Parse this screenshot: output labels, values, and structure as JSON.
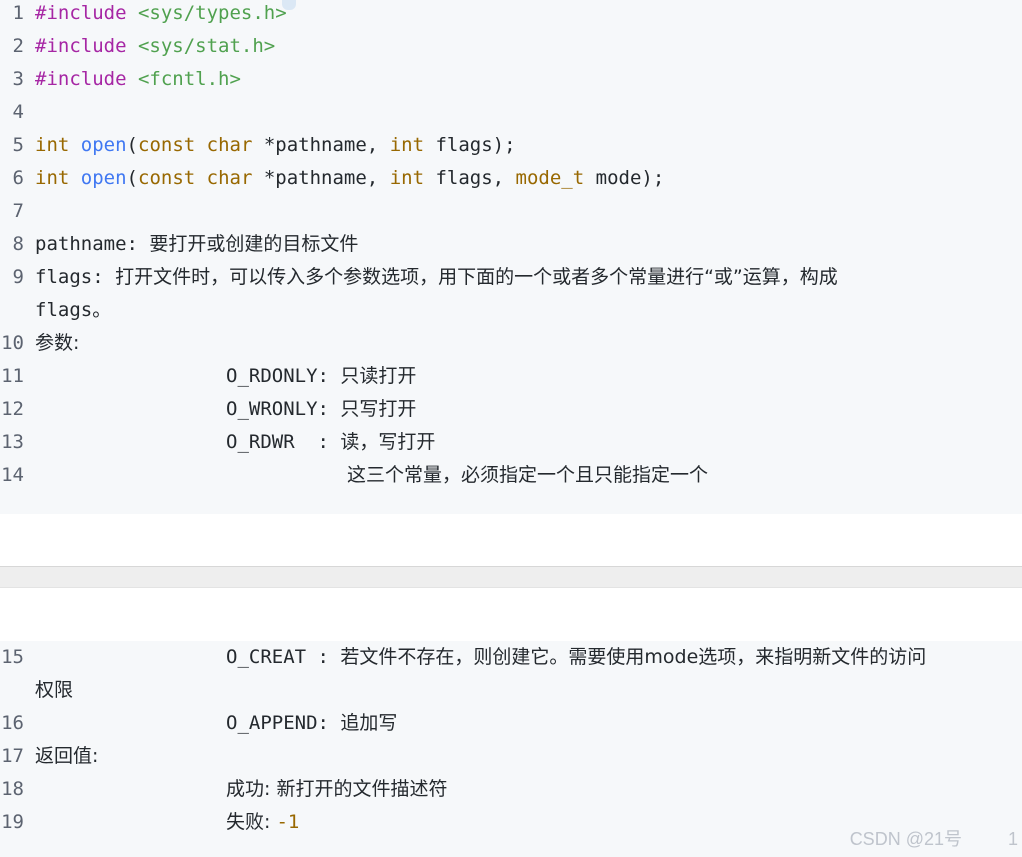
{
  "block1": [
    {
      "n": "1",
      "parts": [
        {
          "t": "#include",
          "c": "kw"
        },
        {
          "t": " "
        },
        {
          "t": "<sys/types.h>",
          "c": "str"
        }
      ]
    },
    {
      "n": "2",
      "parts": [
        {
          "t": "#include",
          "c": "kw"
        },
        {
          "t": " "
        },
        {
          "t": "<sys/stat.h>",
          "c": "str"
        }
      ]
    },
    {
      "n": "3",
      "parts": [
        {
          "t": "#include",
          "c": "kw"
        },
        {
          "t": " "
        },
        {
          "t": "<fcntl.h>",
          "c": "str"
        }
      ]
    },
    {
      "n": "4",
      "parts": []
    },
    {
      "n": "5",
      "parts": [
        {
          "t": "int",
          "c": "type"
        },
        {
          "t": " "
        },
        {
          "t": "open",
          "c": "fn"
        },
        {
          "t": "("
        },
        {
          "t": "const",
          "c": "type"
        },
        {
          "t": " "
        },
        {
          "t": "char",
          "c": "type"
        },
        {
          "t": " *pathname, "
        },
        {
          "t": "int",
          "c": "type"
        },
        {
          "t": " flags);"
        }
      ]
    },
    {
      "n": "6",
      "parts": [
        {
          "t": "int",
          "c": "type"
        },
        {
          "t": " "
        },
        {
          "t": "open",
          "c": "fn"
        },
        {
          "t": "("
        },
        {
          "t": "const",
          "c": "type"
        },
        {
          "t": " "
        },
        {
          "t": "char",
          "c": "type"
        },
        {
          "t": " *pathname, "
        },
        {
          "t": "int",
          "c": "type"
        },
        {
          "t": " flags, "
        },
        {
          "t": "mode_t",
          "c": "type"
        },
        {
          "t": " mode);"
        }
      ]
    },
    {
      "n": "7",
      "parts": []
    },
    {
      "n": "8",
      "parts": [
        {
          "t": "pathname: "
        },
        {
          "t": "要打开或创建的目标文件",
          "c": "cjk"
        }
      ]
    },
    {
      "n": "9",
      "parts": [
        {
          "t": "flags: "
        },
        {
          "t": "打开文件时，可以传入多个参数选项，用下面的一个或者多个常量进行“或”运算，构成",
          "c": "cjk"
        }
      ],
      "cont": [
        {
          "t": "flags"
        },
        {
          "t": "。",
          "c": "cjk"
        }
      ]
    },
    {
      "n": "10",
      "parts": [
        {
          "t": "参数:",
          "c": "cjk"
        }
      ]
    },
    {
      "n": "11",
      "indent": 1,
      "parts": [
        {
          "t": "O_RDONLY: "
        },
        {
          "t": "只读打开",
          "c": "cjk"
        }
      ]
    },
    {
      "n": "12",
      "indent": 1,
      "parts": [
        {
          "t": "O_WRONLY: "
        },
        {
          "t": "只写打开",
          "c": "cjk"
        }
      ]
    },
    {
      "n": "13",
      "indent": 1,
      "parts": [
        {
          "t": "O_RDWR  : "
        },
        {
          "t": "读，写打开",
          "c": "cjk"
        }
      ]
    },
    {
      "n": "14",
      "indent": 2,
      "parts": [
        {
          "t": "这三个常量，必须指定一个且只能指定一个",
          "c": "cjk"
        }
      ]
    }
  ],
  "block2": [
    {
      "n": "15",
      "indent": 1,
      "parts": [
        {
          "t": "O_CREAT : "
        },
        {
          "t": "若文件不存在，则创建它。需要使用mode选项，来指明新文件的访问",
          "c": "cjk"
        }
      ],
      "cont": [
        {
          "t": "权限",
          "c": "cjk"
        }
      ]
    },
    {
      "n": "16",
      "indent": 1,
      "parts": [
        {
          "t": "O_APPEND: "
        },
        {
          "t": "追加写",
          "c": "cjk"
        }
      ]
    },
    {
      "n": "17",
      "parts": [
        {
          "t": "返回值:",
          "c": "cjk"
        }
      ]
    },
    {
      "n": "18",
      "indent": 1,
      "parts": [
        {
          "t": "成功: 新打开的文件描述符",
          "c": "cjk"
        }
      ]
    },
    {
      "n": "19",
      "indent": 1,
      "parts": [
        {
          "t": "失败: ",
          "c": "cjk"
        },
        {
          "t": "-1",
          "c": "num"
        }
      ]
    }
  ],
  "watermark": "CSDN @21号",
  "page_marker": "1"
}
